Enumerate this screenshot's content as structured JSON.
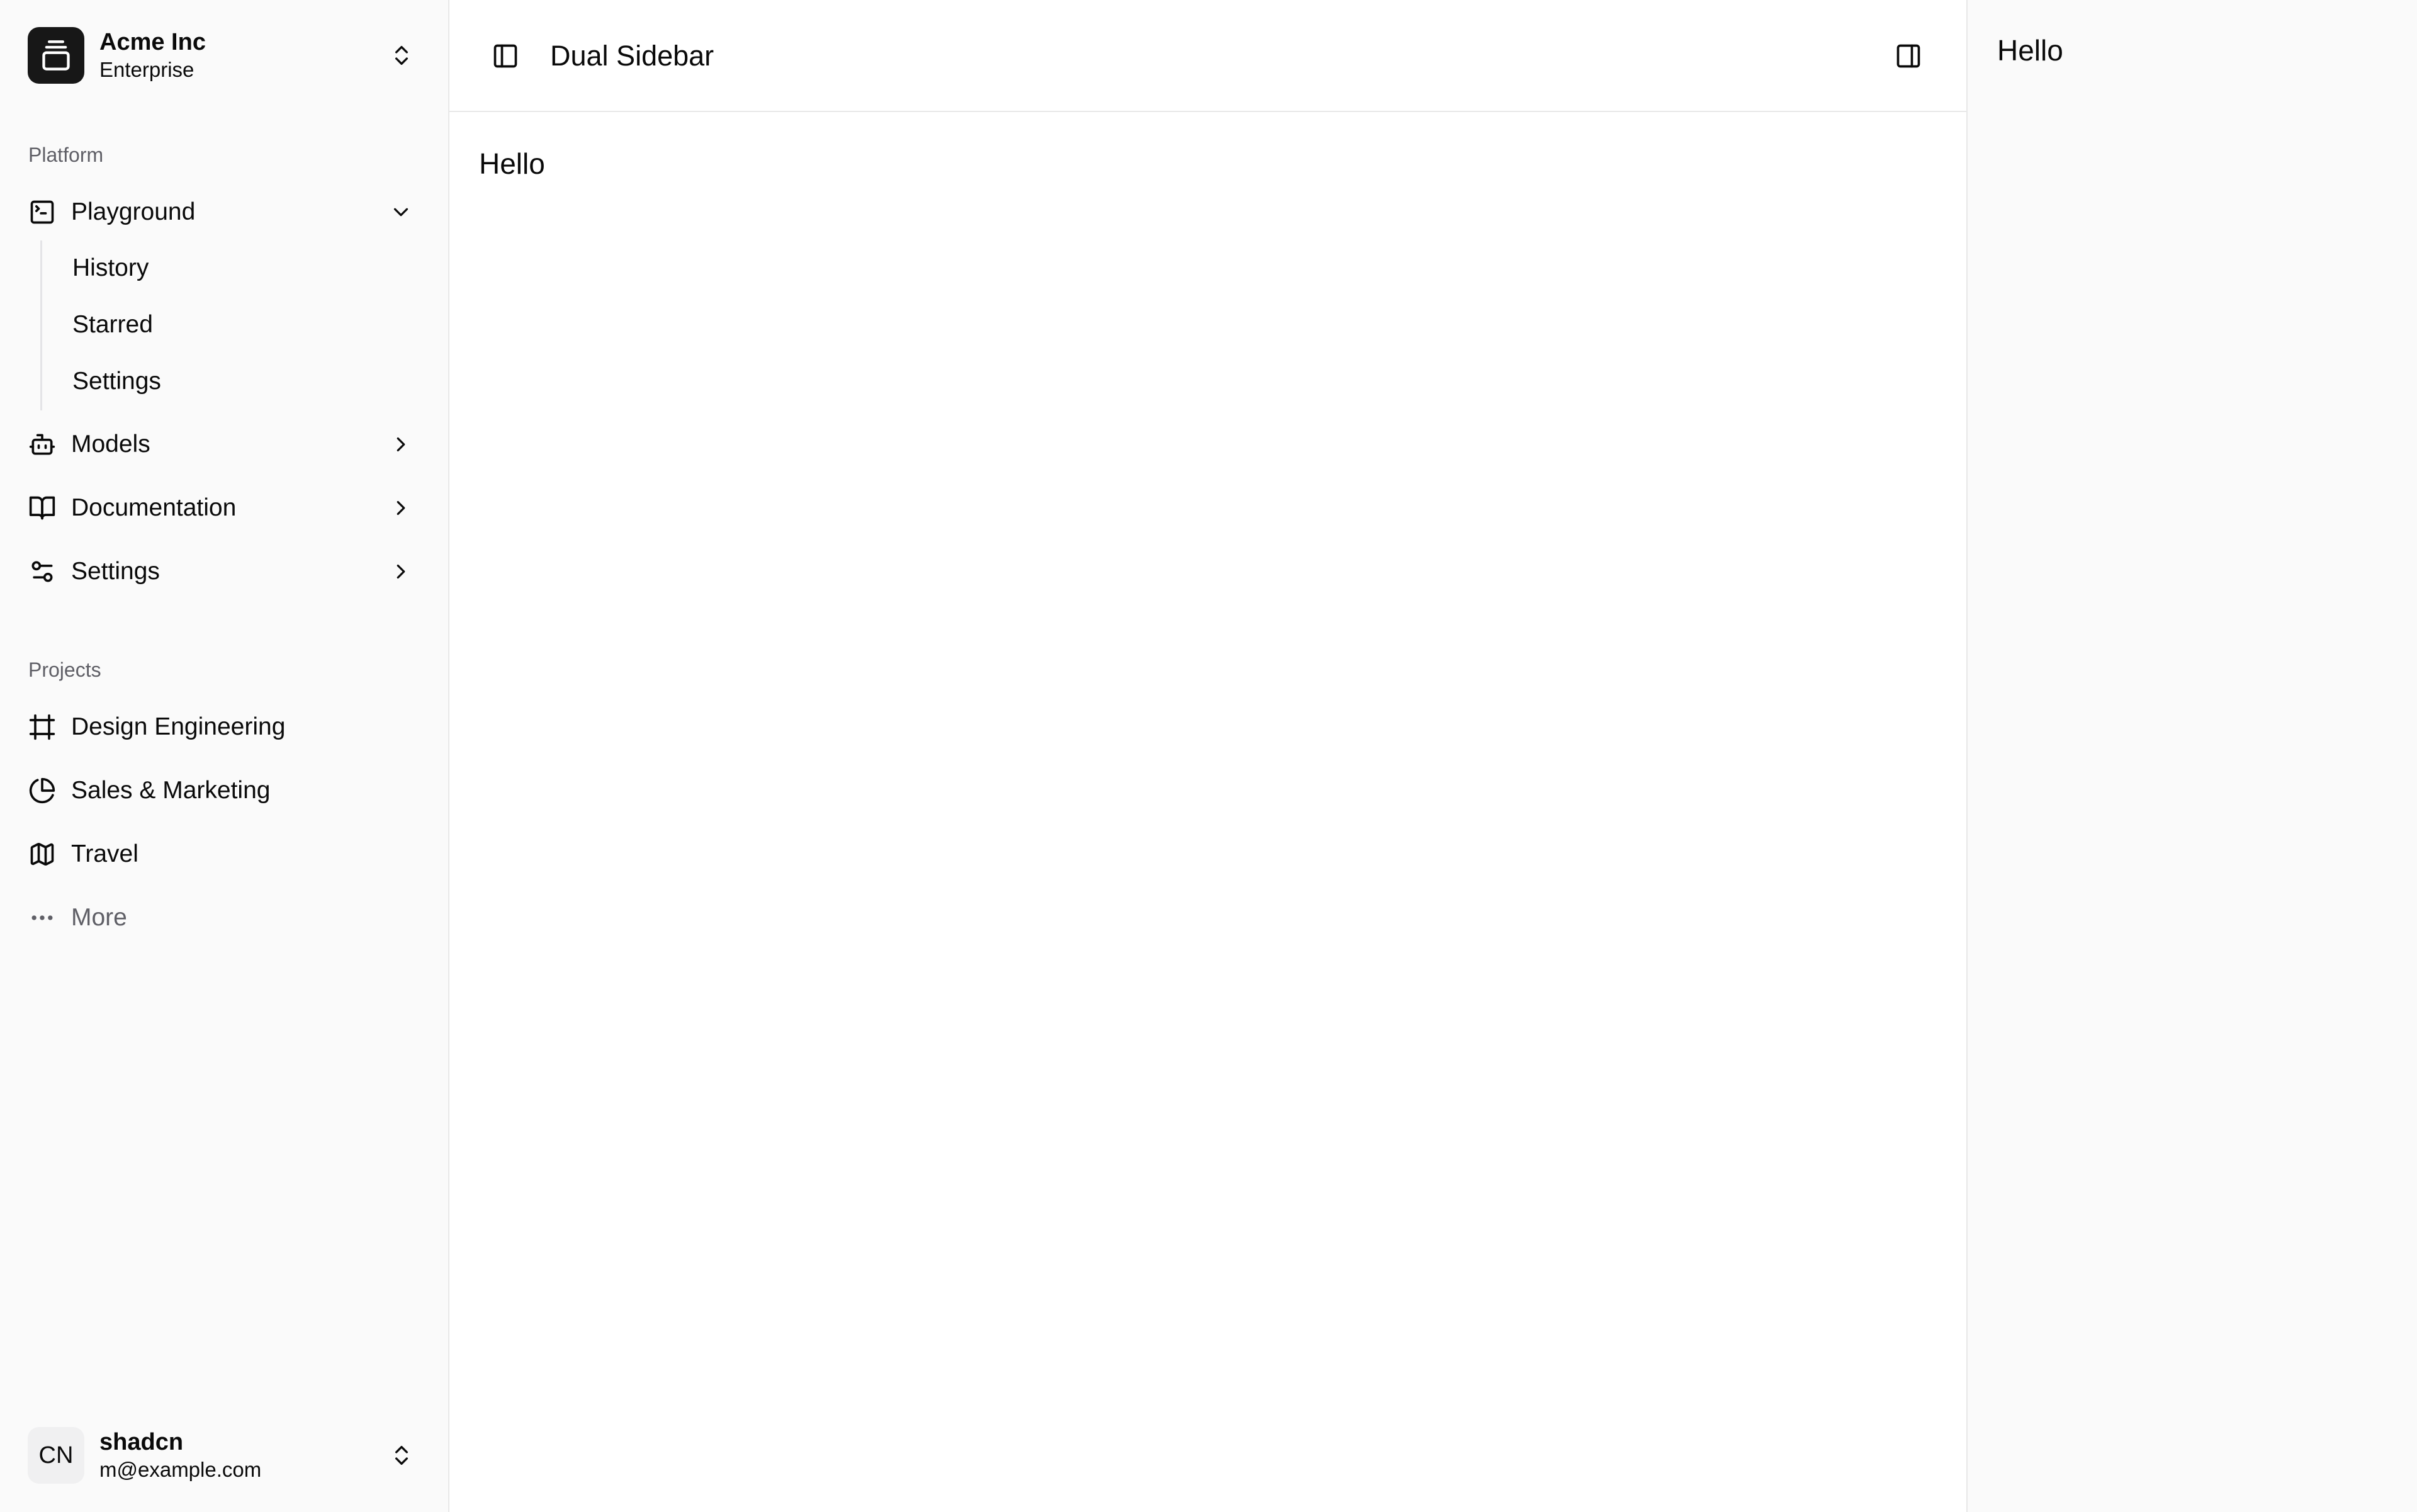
{
  "team": {
    "name": "Acme Inc",
    "plan": "Enterprise"
  },
  "platform": {
    "label": "Platform",
    "items": [
      {
        "label": "Playground",
        "icon": "square-terminal-icon"
      },
      {
        "label": "Models",
        "icon": "bot-icon"
      },
      {
        "label": "Documentation",
        "icon": "book-open-icon"
      },
      {
        "label": "Settings",
        "icon": "settings-sliders-icon"
      }
    ],
    "playground_sub": [
      "History",
      "Starred",
      "Settings"
    ]
  },
  "projects": {
    "label": "Projects",
    "items": [
      {
        "label": "Design Engineering",
        "icon": "frame-icon"
      },
      {
        "label": "Sales & Marketing",
        "icon": "pie-chart-icon"
      },
      {
        "label": "Travel",
        "icon": "map-icon"
      }
    ],
    "more_label": "More"
  },
  "user": {
    "initials": "CN",
    "name": "shadcn",
    "email": "m@example.com"
  },
  "header": {
    "title": "Dual Sidebar"
  },
  "main": {
    "content": "Hello"
  },
  "right_sidebar": {
    "content": "Hello"
  }
}
